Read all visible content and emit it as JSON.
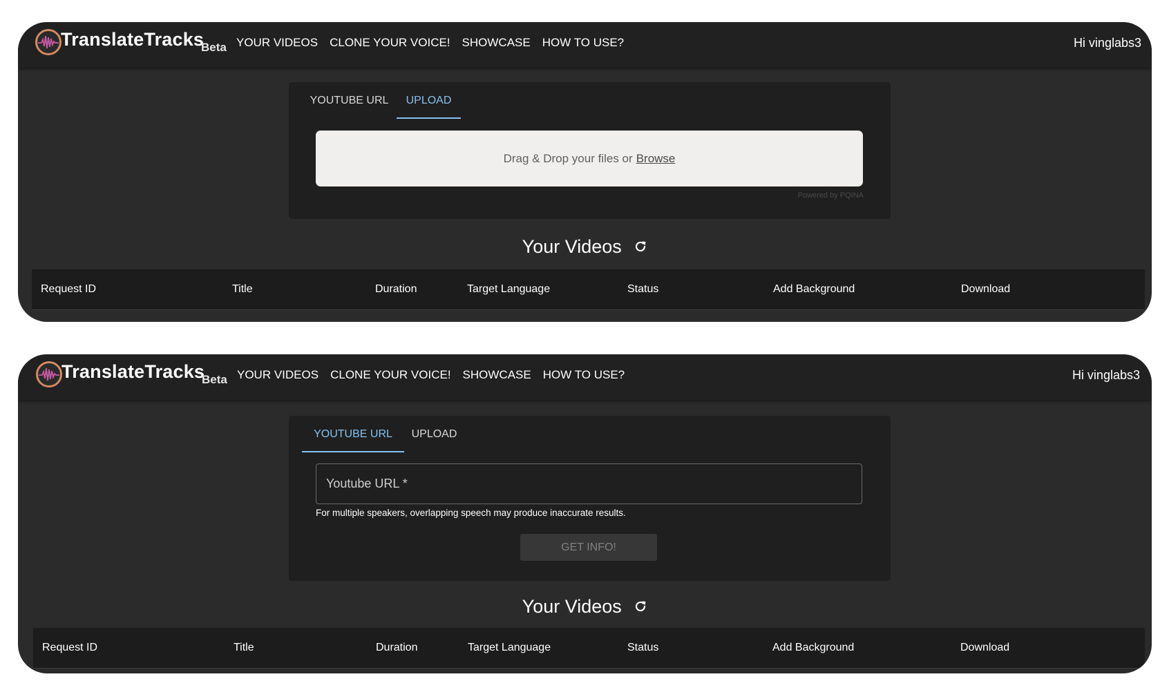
{
  "brand": {
    "name": "TranslateTracks",
    "badge": "Beta"
  },
  "nav": [
    "YOUR VIDEOS",
    "CLONE YOUR VOICE!",
    "SHOWCASE",
    "HOW TO USE?"
  ],
  "user": {
    "greeting": "Hi vinglabs3"
  },
  "tabs": {
    "youtube": "YOUTUBE URL",
    "upload": "UPLOAD"
  },
  "upload": {
    "prompt": "Drag & Drop your files or",
    "browse": "Browse",
    "powered_by": "Powered by PQINA"
  },
  "youtube_form": {
    "placeholder": "Youtube URL *",
    "helper": "For multiple speakers, overlapping speech may produce inaccurate results.",
    "button": "GET INFO!"
  },
  "videos": {
    "title": "Your Videos",
    "columns": [
      "Request ID",
      "Title",
      "Duration",
      "Target Language",
      "Status",
      "Add Background",
      "Download"
    ]
  },
  "colors": {
    "accent": "#86c1ef",
    "panel": "#2b2b2b",
    "navbar": "#212121",
    "card": "#1f1f1f"
  },
  "icons": {
    "logo": "soundwave-globe-icon",
    "refresh": "refresh-icon"
  }
}
